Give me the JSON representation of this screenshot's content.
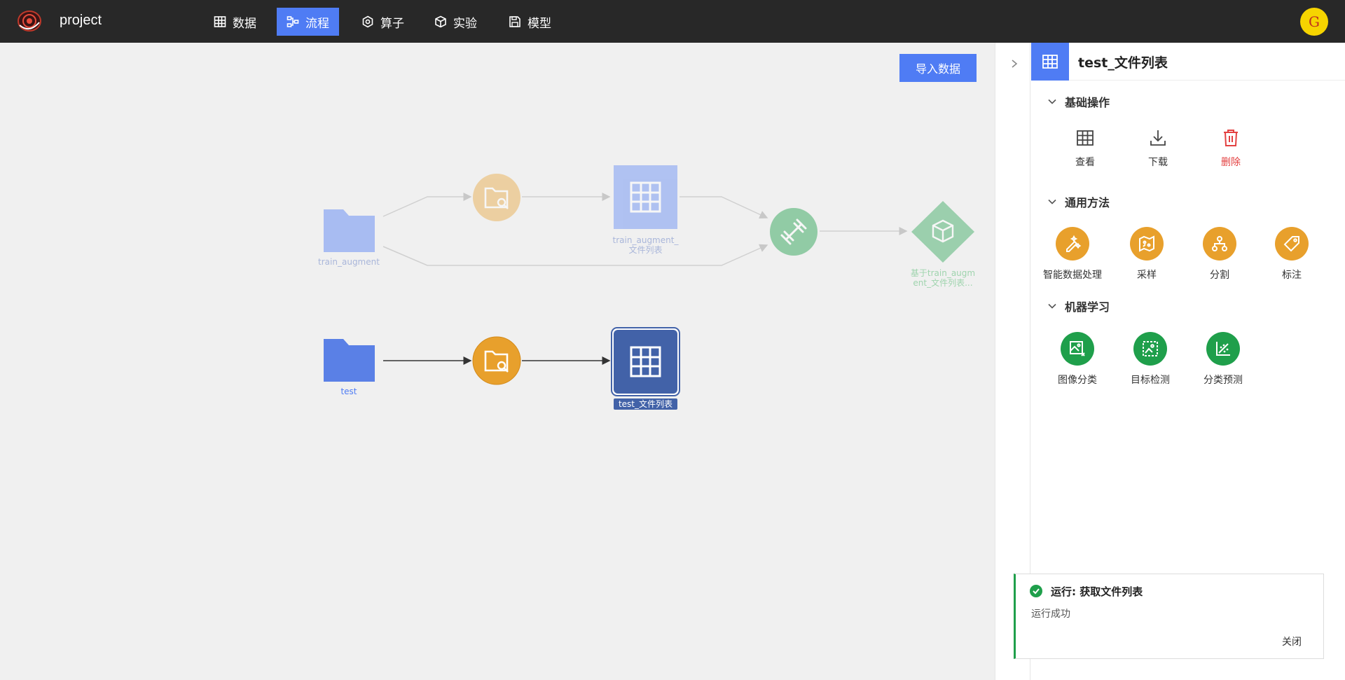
{
  "nav": {
    "brand": "project",
    "items": [
      {
        "label": "数据",
        "icon": "table-icon"
      },
      {
        "label": "流程",
        "icon": "flow-icon",
        "active": true
      },
      {
        "label": "算子",
        "icon": "hexagon-icon"
      },
      {
        "label": "实验",
        "icon": "cube-icon"
      },
      {
        "label": "模型",
        "icon": "save-icon"
      }
    ],
    "avatar_letter": "G"
  },
  "canvas": {
    "import_button": "导入数据",
    "nodes": {
      "train_folder": "train_augment",
      "train_table_line1": "train_augment_",
      "train_table_line2": "文件列表",
      "train_model_line1": "基于train_augm",
      "train_model_line2": "ent_文件列表...",
      "test_folder": "test",
      "test_table": "test_文件列表"
    }
  },
  "panel": {
    "title": "test_文件列表",
    "sections": {
      "basic": {
        "title": "基础操作",
        "ops": [
          {
            "label": "查看",
            "icon": "table-icon"
          },
          {
            "label": "下载",
            "icon": "download-icon"
          },
          {
            "label": "删除",
            "icon": "trash-icon",
            "danger": true
          }
        ]
      },
      "general": {
        "title": "通用方法",
        "items": [
          {
            "label": "智能数据处理",
            "icon": "magic-pen-icon"
          },
          {
            "label": "采样",
            "icon": "map-icon"
          },
          {
            "label": "分割",
            "icon": "split-icon"
          },
          {
            "label": "标注",
            "icon": "tag-icon"
          }
        ]
      },
      "ml": {
        "title": "机器学习",
        "items": [
          {
            "label": "图像分类",
            "icon": "image-class-icon"
          },
          {
            "label": "目标检测",
            "icon": "object-detect-icon"
          },
          {
            "label": "分类预测",
            "icon": "scatter-icon"
          }
        ]
      }
    }
  },
  "toast": {
    "title": "运行: 获取文件列表",
    "message": "运行成功",
    "close": "关闭"
  },
  "colors": {
    "accent": "#4f7cf4",
    "topbar": "#282828",
    "orange": "#e8a02c",
    "green": "#1f9f4b",
    "danger": "#e34040"
  }
}
